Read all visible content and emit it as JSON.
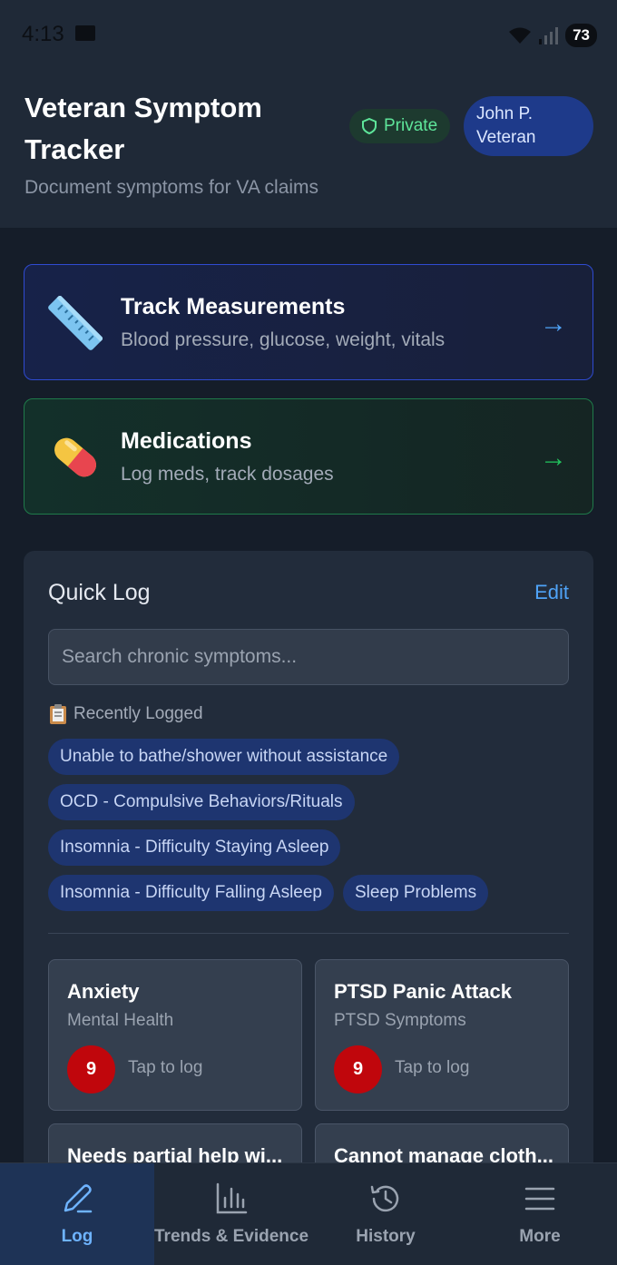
{
  "status_bar": {
    "time": "4:13",
    "battery": "73"
  },
  "header": {
    "title": "Veteran Symptom Tracker",
    "subtitle": "Document symptoms for VA claims",
    "privacy_badge": "Private",
    "user_name": "John P. Veteran"
  },
  "cards": {
    "measurements": {
      "title": "Track Measurements",
      "subtitle": "Blood pressure, glucose, weight, vitals",
      "icon": "ruler-icon",
      "arrow": "→"
    },
    "medications": {
      "title": "Medications",
      "subtitle": "Log meds, track dosages",
      "icon": "pill-icon",
      "arrow": "→"
    }
  },
  "quick_log": {
    "title": "Quick Log",
    "edit_label": "Edit",
    "search_placeholder": "Search chronic symptoms...",
    "recent_label": "Recently Logged",
    "recent_chips": [
      "Unable to bathe/shower without assistance",
      "OCD - Compulsive Behaviors/Rituals",
      "Insomnia - Difficulty Staying Asleep",
      "Insomnia - Difficulty Falling Asleep",
      "Sleep Problems"
    ],
    "symptoms": [
      {
        "name": "Anxiety",
        "category": "Mental Health",
        "count": "9",
        "tap": "Tap to log"
      },
      {
        "name": "PTSD Panic Attack",
        "category": "PTSD Symptoms",
        "count": "9",
        "tap": "Tap to log"
      },
      {
        "name": "Needs partial help wi...",
        "category": "",
        "count": "",
        "tap": ""
      },
      {
        "name": "Cannot manage cloth...",
        "category": "",
        "count": "",
        "tap": ""
      }
    ]
  },
  "nav": [
    {
      "label": "Log",
      "icon": "pencil-icon",
      "active": true
    },
    {
      "label": "Trends & Evidence",
      "icon": "bar-chart-icon",
      "active": false
    },
    {
      "label": "History",
      "icon": "history-icon",
      "active": false
    },
    {
      "label": "More",
      "icon": "menu-icon",
      "active": false
    }
  ],
  "colors": {
    "accent_blue": "#4fa3f7",
    "accent_green": "#22c55e",
    "badge_red": "#c0060c",
    "background": "#151d29"
  }
}
